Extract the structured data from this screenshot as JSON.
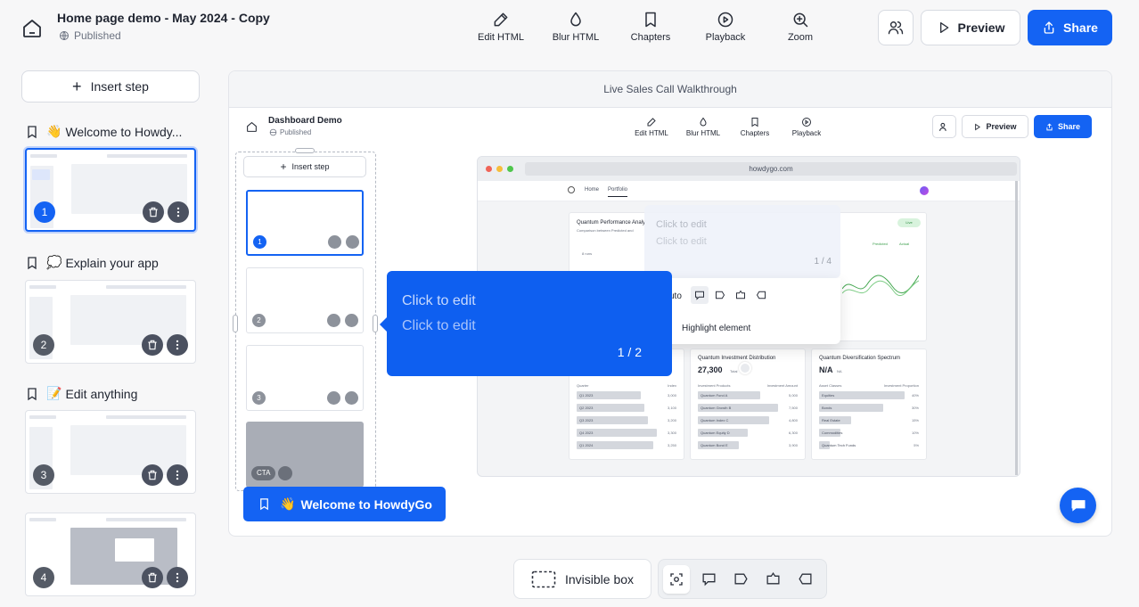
{
  "header": {
    "title": "Home page demo - May 2024 - Copy",
    "status": "Published",
    "tools": [
      {
        "label": "Edit HTML",
        "icon": "pencil-icon"
      },
      {
        "label": "Blur HTML",
        "icon": "droplet-icon"
      },
      {
        "label": "Chapters",
        "icon": "bookmark-icon"
      },
      {
        "label": "Playback",
        "icon": "play-circle-icon"
      },
      {
        "label": "Zoom",
        "icon": "zoom-in-icon"
      }
    ],
    "preview_label": "Preview",
    "share_label": "Share"
  },
  "sidebar": {
    "insert_step_label": "Insert step",
    "chapters": [
      {
        "emoji": "👋",
        "title": "Welcome to Howdy..."
      },
      {
        "emoji": "💭",
        "title": "Explain your app"
      },
      {
        "emoji": "📝",
        "title": "Edit anything"
      }
    ],
    "steps": [
      "1",
      "2",
      "3",
      "4"
    ]
  },
  "canvas": {
    "title": "Live Sales Call Walkthrough",
    "inner_header": {
      "title": "Dashboard Demo",
      "status": "Published",
      "tools": [
        "Edit HTML",
        "Blur HTML",
        "Chapters",
        "Playback"
      ],
      "preview_label": "Preview",
      "share_label": "Share"
    },
    "inner_sidebar": {
      "insert_step_label": "Insert step",
      "steps": [
        "1",
        "2",
        "3"
      ],
      "cta_label": "CTA"
    },
    "chapter_tag": {
      "emoji": "👋",
      "label": "Welcome to HowdyGo"
    },
    "browser": {
      "url": "howdygo.com",
      "nav": [
        "Home",
        "Portfolio"
      ],
      "card_perf": {
        "title": "Quantum Performance Analy",
        "subtitle": "Comparison between Predicted and",
        "tick": "8 runs",
        "badge": "Live",
        "legend_predicted": "Predicted",
        "legend_actual": "Actual"
      },
      "card_left": {
        "col1": "Quarter",
        "col2": "Index",
        "rows": [
          {
            "label": "Q1 2023",
            "value": "3,000"
          },
          {
            "label": "Q2 2023",
            "value": "3,100"
          },
          {
            "label": "Q3 2023",
            "value": "3,200"
          },
          {
            "label": "Q4 2023",
            "value": "3,300"
          },
          {
            "label": "Q1 2024",
            "value": "3,250"
          }
        ]
      },
      "card_mid": {
        "title": "Quantum Investment Distribution",
        "value": "27,300",
        "value_suffix": "Total",
        "col1": "Investment Products",
        "col2": "Investment Amount",
        "rows": [
          {
            "label": "Quantum Fund A",
            "value": "5,000"
          },
          {
            "label": "Quantum Growth B",
            "value": "7,500"
          },
          {
            "label": "Quantum Index C",
            "value": "4,800"
          },
          {
            "label": "Quantum Equity D",
            "value": "6,300"
          },
          {
            "label": "Quantum Bond E",
            "value": "3,900"
          }
        ]
      },
      "card_right": {
        "title": "Quantum Diversification Spectrum",
        "value": "N/A",
        "value_suffix": "NA",
        "col1": "Asset Classes",
        "col2": "Investment Proportion",
        "rows": [
          {
            "label": "Equities",
            "value": "40%"
          },
          {
            "label": "Bonds",
            "value": "30%"
          },
          {
            "label": "Real Estate",
            "value": "15%"
          },
          {
            "label": "Commodities",
            "value": "10%"
          },
          {
            "label": "Quantum Tech Funds",
            "value": "5%"
          }
        ]
      }
    },
    "ghost_tooltip": {
      "title": "Click to edit",
      "body": "Click to edit",
      "count": "1 / 4",
      "auto_label": "uto",
      "highlight_label": "Highlight element"
    },
    "tooltip": {
      "title": "Click to edit",
      "body": "Click to edit",
      "count": "1 / 2"
    }
  },
  "bottom": {
    "invisible_box_label": "Invisible box"
  },
  "colors": {
    "accent": "#1463f3"
  }
}
